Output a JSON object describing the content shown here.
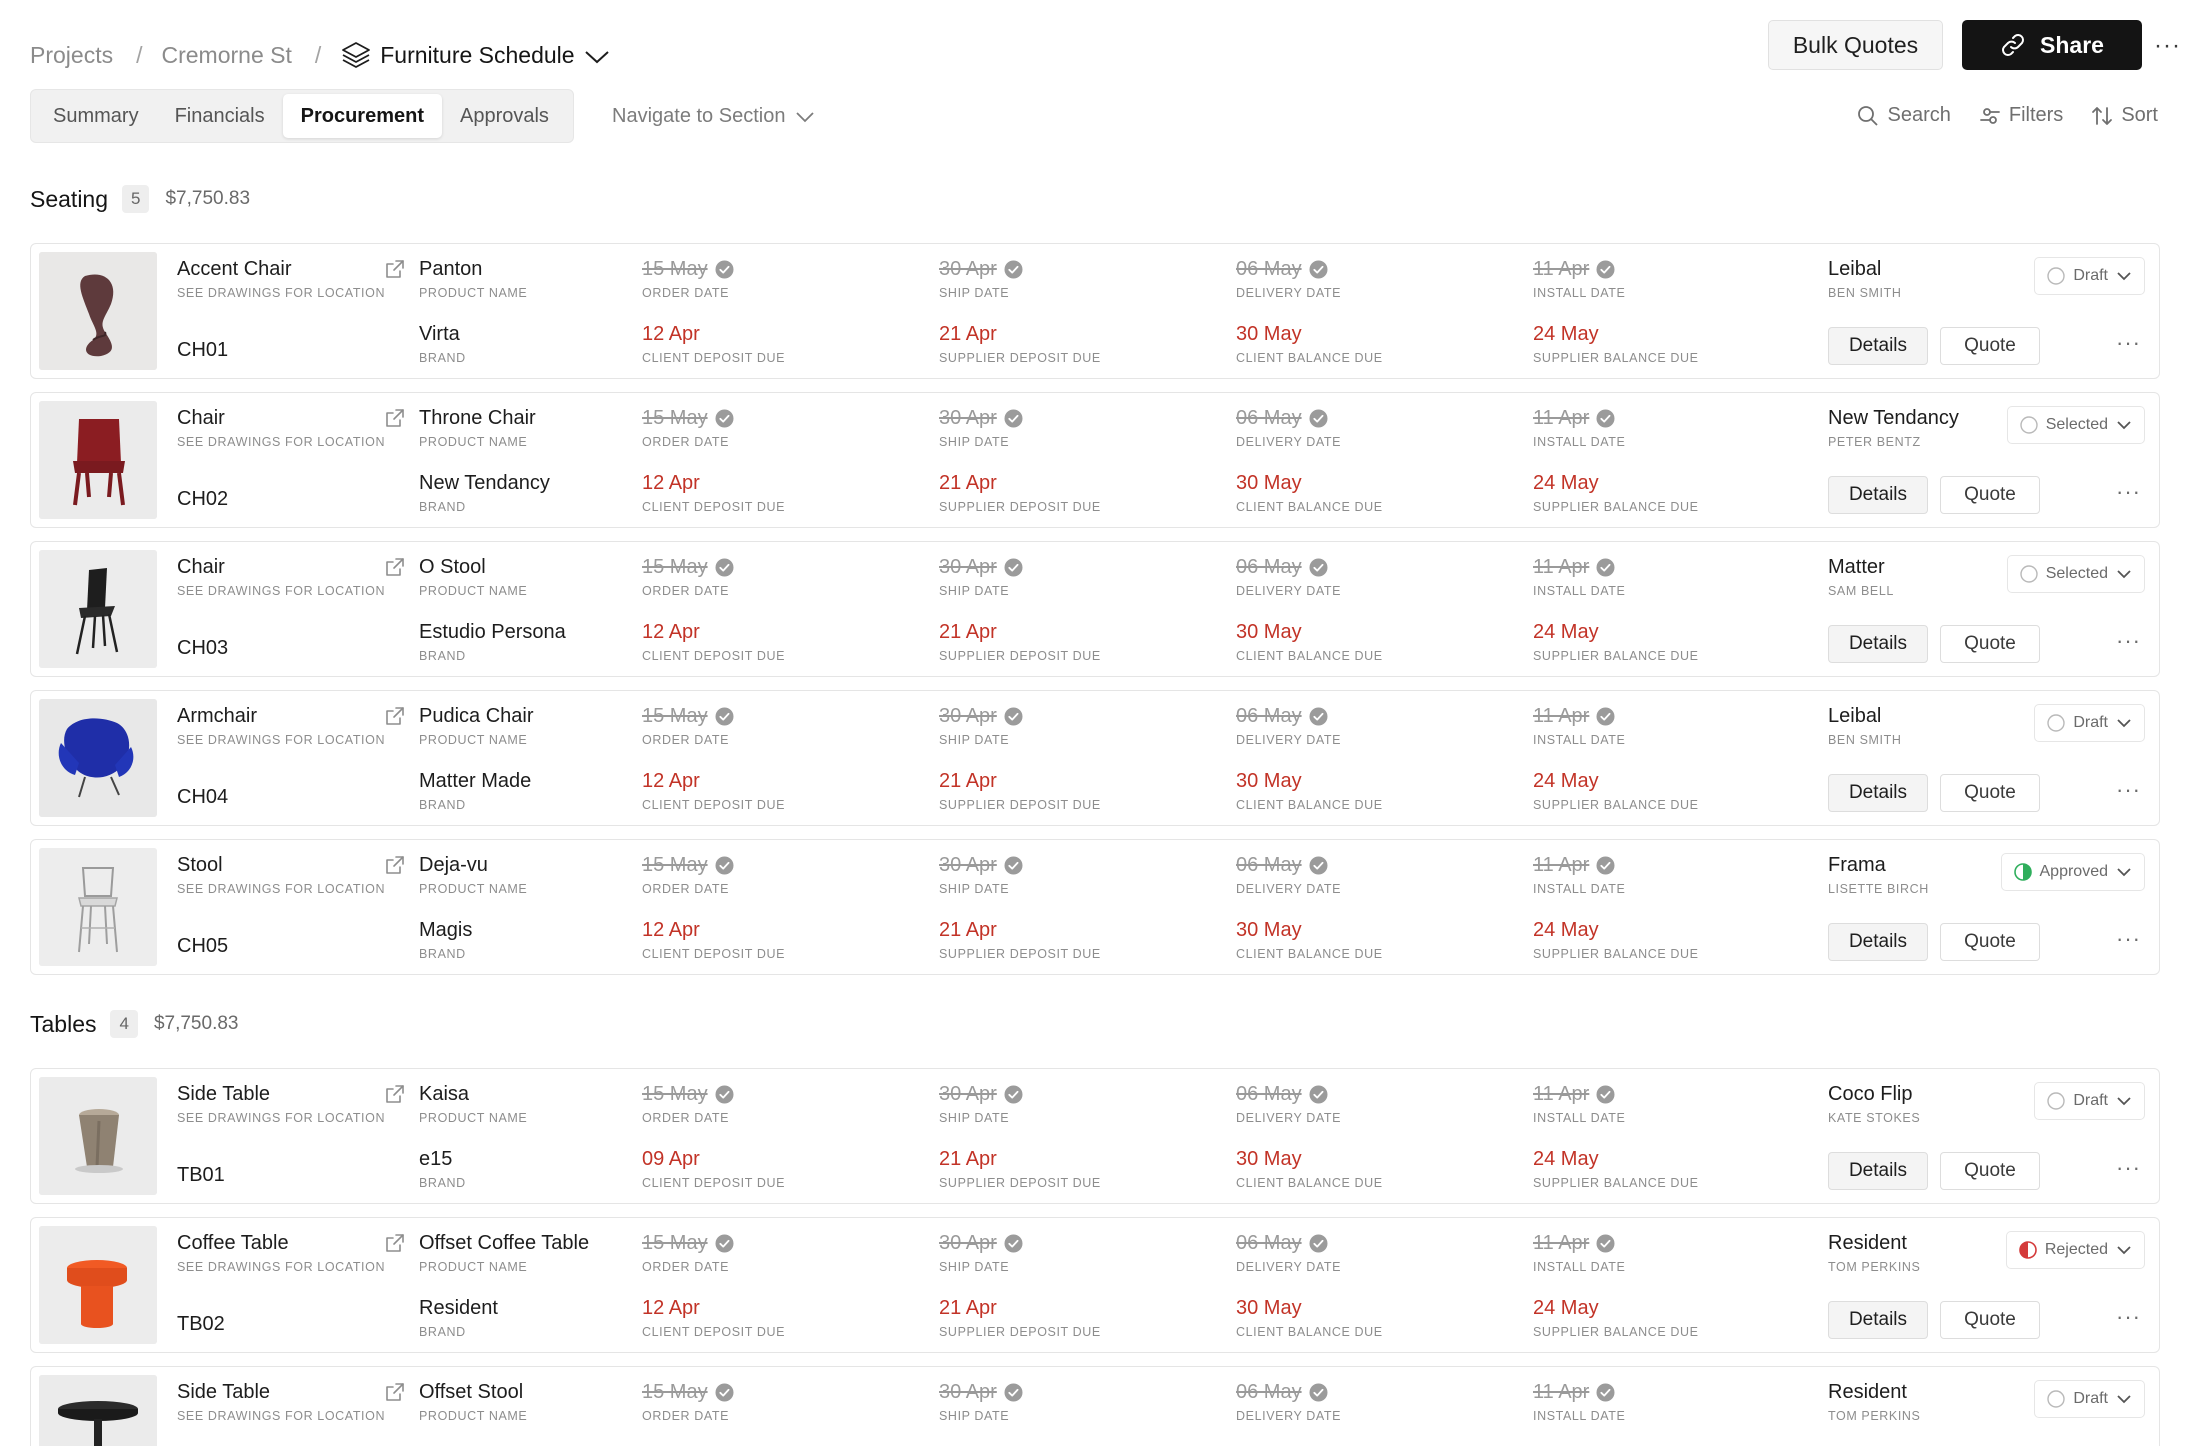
{
  "breadcrumb": {
    "projects": "Projects",
    "project": "Cremorne St",
    "current": "Furniture Schedule"
  },
  "header": {
    "bulk_quotes": "Bulk Quotes",
    "share": "Share",
    "more": "···"
  },
  "tabs": [
    "Summary",
    "Financials",
    "Procurement",
    "Approvals"
  ],
  "active_tab": "Procurement",
  "navigate": "Navigate to Section",
  "tools": {
    "search": "Search",
    "filters": "Filters",
    "sort": "Sort"
  },
  "labels": {
    "location": "SEE DRAWINGS FOR LOCATION",
    "product_name": "PRODUCT NAME",
    "brand": "BRAND",
    "order_date": "ORDER DATE",
    "ship_date": "SHIP DATE",
    "delivery_date": "DELIVERY DATE",
    "install_date": "INSTALL DATE",
    "client_deposit": "CLIENT DEPOSIT DUE",
    "supplier_deposit": "SUPPLIER DEPOSIT DUE",
    "client_balance": "CLIENT BALANCE DUE",
    "supplier_balance": "SUPPLIER BALANCE DUE",
    "details": "Details",
    "quote": "Quote",
    "more": "···"
  },
  "groups": [
    {
      "title": "Seating",
      "count": "5",
      "total": "$7,750.83",
      "items": [
        {
          "type": "Accent Chair",
          "code": "CH01",
          "product": "Panton",
          "brand": "Virta",
          "order": "15 May",
          "ship": "30 Apr",
          "delivery": "06 May",
          "install": "11 Apr",
          "client_deposit": "12 Apr",
          "supplier_deposit": "21 Apr",
          "client_balance": "30 May",
          "supplier_balance": "24 May",
          "supplier": "Leibal",
          "contact": "BEN SMITH",
          "status": "Draft",
          "status_color": "#b9b9b9",
          "image": "accent-chair-image"
        },
        {
          "type": "Chair",
          "code": "CH02",
          "product": "Throne Chair",
          "brand": "New Tendancy",
          "order": "15 May",
          "ship": "30 Apr",
          "delivery": "06 May",
          "install": "11 Apr",
          "client_deposit": "12 Apr",
          "supplier_deposit": "21 Apr",
          "client_balance": "30 May",
          "supplier_balance": "24 May",
          "supplier": "New Tendancy",
          "contact": "PETER BENTZ",
          "status": "Selected",
          "status_color": "#b9b9b9",
          "image": "red-chair-image"
        },
        {
          "type": "Chair",
          "code": "CH03",
          "product": "O Stool",
          "brand": "Estudio Persona",
          "order": "15 May",
          "ship": "30 Apr",
          "delivery": "06 May",
          "install": "11 Apr",
          "client_deposit": "12 Apr",
          "supplier_deposit": "21 Apr",
          "client_balance": "30 May",
          "supplier_balance": "24 May",
          "supplier": "Matter",
          "contact": "SAM BELL",
          "status": "Selected",
          "status_color": "#b9b9b9",
          "image": "black-chair-image"
        },
        {
          "type": "Armchair",
          "code": "CH04",
          "product": "Pudica Chair",
          "brand": "Matter Made",
          "order": "15 May",
          "ship": "30 Apr",
          "delivery": "06 May",
          "install": "11 Apr",
          "client_deposit": "12 Apr",
          "supplier_deposit": "21 Apr",
          "client_balance": "30 May",
          "supplier_balance": "24 May",
          "supplier": "Leibal",
          "contact": "BEN SMITH",
          "status": "Draft",
          "status_color": "#b9b9b9",
          "image": "blue-armchair-image"
        },
        {
          "type": "Stool",
          "code": "CH05",
          "product": "Deja-vu",
          "brand": "Magis",
          "order": "15 May",
          "ship": "30 Apr",
          "delivery": "06 May",
          "install": "11 Apr",
          "client_deposit": "12 Apr",
          "supplier_deposit": "21 Apr",
          "client_balance": "30 May",
          "supplier_balance": "24 May",
          "supplier": "Frama",
          "contact": "LISETTE BIRCH",
          "status": "Approved",
          "status_color": "#2fae5c",
          "image": "clear-stool-image"
        }
      ]
    },
    {
      "title": "Tables",
      "count": "4",
      "total": "$7,750.83",
      "items": [
        {
          "type": "Side Table",
          "code": "TB01",
          "product": "Kaisa",
          "brand": "e15",
          "order": "15 May",
          "ship": "30 Apr",
          "delivery": "06 May",
          "install": "11 Apr",
          "client_deposit": "09 Apr",
          "supplier_deposit": "21 Apr",
          "client_balance": "30 May",
          "supplier_balance": "24 May",
          "supplier": "Coco Flip",
          "contact": "KATE STOKES",
          "status": "Draft",
          "status_color": "#b9b9b9",
          "image": "side-table-image"
        },
        {
          "type": "Coffee Table",
          "code": "TB02",
          "product": "Offset Coffee Table",
          "brand": "Resident",
          "order": "15 May",
          "ship": "30 Apr",
          "delivery": "06 May",
          "install": "11 Apr",
          "client_deposit": "12 Apr",
          "supplier_deposit": "21 Apr",
          "client_balance": "30 May",
          "supplier_balance": "24 May",
          "supplier": "Resident",
          "contact": "TOM PERKINS",
          "status": "Rejected",
          "status_color": "#d43a3a",
          "image": "orange-table-image"
        },
        {
          "type": "Side Table",
          "code": "",
          "product": "Offset Stool",
          "brand": "",
          "order": "15 May",
          "ship": "30 Apr",
          "delivery": "06 May",
          "install": "11 Apr",
          "client_deposit": "",
          "supplier_deposit": "",
          "client_balance": "",
          "supplier_balance": "",
          "supplier": "Resident",
          "contact": "TOM PERKINS",
          "status": "Draft",
          "status_color": "#b9b9b9",
          "image": "dark-side-table-image"
        }
      ]
    }
  ]
}
